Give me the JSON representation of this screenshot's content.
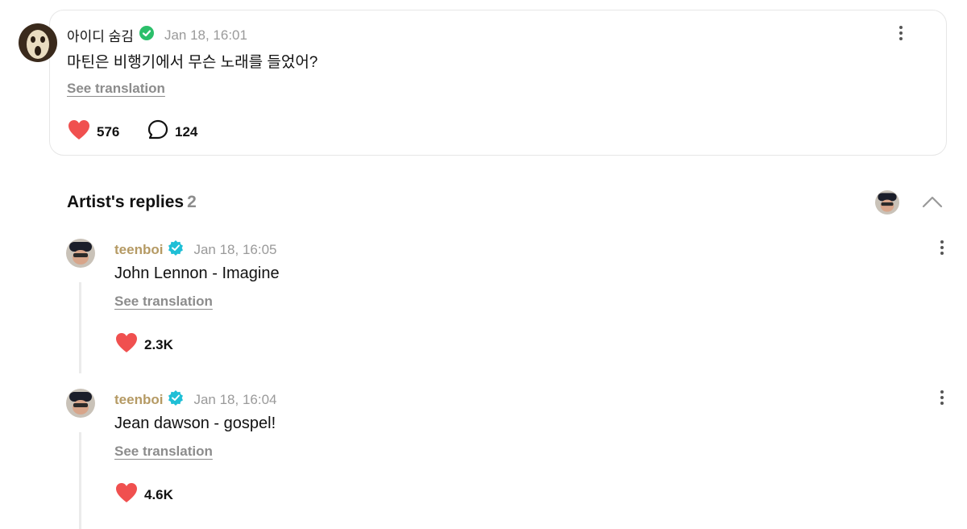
{
  "post": {
    "author": "아이디 숨김",
    "timestamp": "Jan 18, 16:01",
    "text": "마틴은 비행기에서 무슨 노래를 들었어?",
    "see_translation": "See translation",
    "likes": "576",
    "comments": "124"
  },
  "replies_section": {
    "title": "Artist's replies",
    "count": "2"
  },
  "replies": [
    {
      "author": "teenboi",
      "timestamp": "Jan 18, 16:05",
      "text": "John Lennon - Imagine",
      "see_translation": "See translation",
      "likes": "2.3K"
    },
    {
      "author": "teenboi",
      "timestamp": "Jan 18, 16:04",
      "text": "Jean dawson - gospel!",
      "see_translation": "See translation",
      "likes": "4.6K"
    }
  ],
  "colors": {
    "heart": "#f0504f",
    "verified_green": "#2bbf6a",
    "verified_teal": "#1fbfd6",
    "artist_name": "#b59a64",
    "muted": "#9a9a9a"
  },
  "icons": {
    "like": "heart-icon",
    "comment": "comment-bubble-icon",
    "more": "more-vertical-icon",
    "collapse": "chevron-up-icon",
    "verified": "verified-badge-icon"
  }
}
